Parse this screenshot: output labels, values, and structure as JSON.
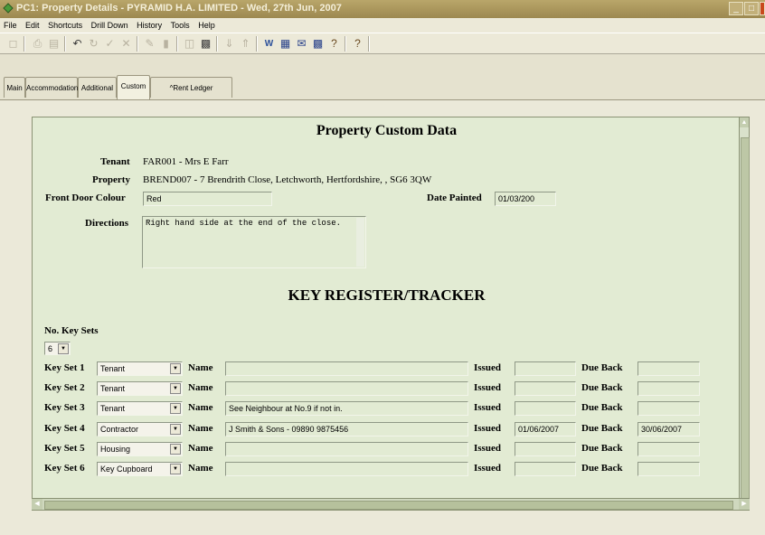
{
  "window": {
    "title": "PC1: Property Details - PYRAMID H.A. LIMITED - Wed, 27th Jun, 2007",
    "controls": [
      "_",
      "□",
      "X"
    ]
  },
  "menu": [
    "File",
    "Edit",
    "Shortcuts",
    "Drill Down",
    "History",
    "Tools",
    "Help"
  ],
  "toolbar": {
    "icons": [
      "pin-icon",
      "print-icon",
      "preview-icon",
      "undo-icon",
      "refresh-icon",
      "tick-icon",
      "cancel-icon",
      "edit-icon",
      "notes-icon",
      "copy-icon",
      "paste-icon",
      "sort-down-icon",
      "sort-up-icon",
      "word-icon",
      "grid-icon",
      "mail-icon",
      "table-icon",
      "help-icon",
      "whats-this-icon"
    ]
  },
  "tabs": [
    {
      "label": "Main",
      "active": false
    },
    {
      "label": "Accommodation",
      "active": false
    },
    {
      "label": "Additional",
      "active": false
    },
    {
      "label": "Custom",
      "active": true
    },
    {
      "label": "^Rent Ledger",
      "active": false
    }
  ],
  "panel": {
    "title": "Property Custom Data",
    "tenant_label": "Tenant",
    "tenant_value": "FAR001 - Mrs E Farr",
    "property_label": "Property",
    "property_value": "BREND007 - 7 Brendrith Close, Letchworth, Hertfordshire, , SG6 3QW",
    "front_door_label": "Front Door Colour",
    "front_door_value": "Red",
    "date_painted_label": "Date Painted",
    "date_painted_value": "01/03/200",
    "directions_label": "Directions",
    "directions_value": "Right hand side at the end of the close.",
    "key_register_title": "KEY REGISTER/TRACKER",
    "no_key_sets_label": "No. Key Sets",
    "no_key_sets_value": "6",
    "name_label": "Name",
    "issued_label": "Issued",
    "due_back_label": "Due Back"
  },
  "key_sets": [
    {
      "label": "Key Set 1",
      "type": "Tenant",
      "name": "",
      "issued": "",
      "due_back": ""
    },
    {
      "label": "Key Set 2",
      "type": "Tenant",
      "name": "",
      "issued": "",
      "due_back": ""
    },
    {
      "label": "Key Set 3",
      "type": "Tenant",
      "name": "See Neighbour at No.9 if not in.",
      "issued": "",
      "due_back": ""
    },
    {
      "label": "Key Set 4",
      "type": "Contractor",
      "name": "J Smith & Sons - 09890 9875456",
      "issued": "01/06/2007",
      "due_back": "30/06/2007"
    },
    {
      "label": "Key Set 5",
      "type": "Housing",
      "name": "",
      "issued": "",
      "due_back": ""
    },
    {
      "label": "Key Set 6",
      "type": "Key Cupboard",
      "name": "",
      "issued": "",
      "due_back": ""
    }
  ],
  "colors": {
    "title_bar": "#a8945a",
    "panel_bg": "#e2ebd3",
    "window_bg": "#ece9d8"
  }
}
